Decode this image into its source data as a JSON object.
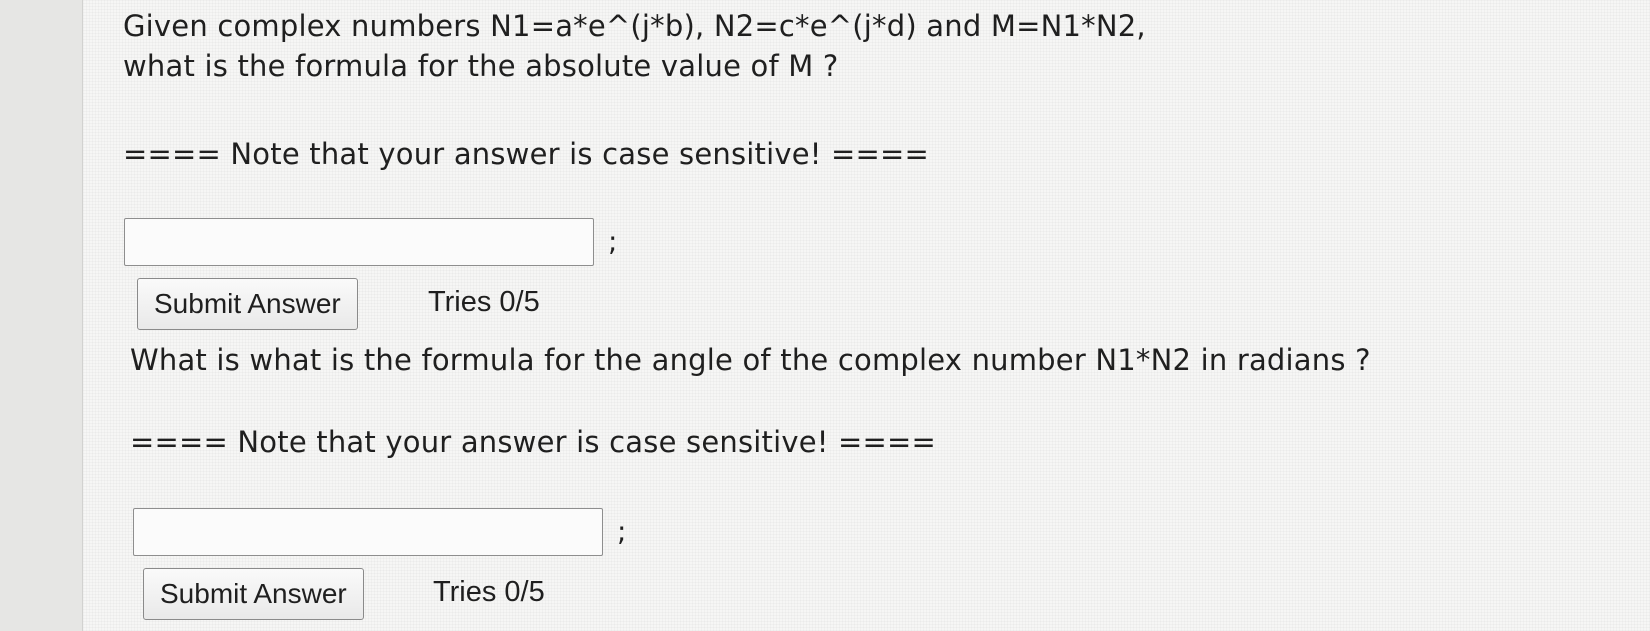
{
  "question1": {
    "line1": "Given complex numbers N1=a*e^(j*b), N2=c*e^(j*d) and M=N1*N2,",
    "line2": "what is the formula for the absolute value of M ?",
    "note": "==== Note that your answer is case sensitive! ====",
    "input_value": "",
    "semicolon": ";",
    "submit_label": "Submit Answer",
    "tries": "Tries 0/5"
  },
  "question2": {
    "line1": "What is what is the formula for the angle of the complex number N1*N2 in radians ?",
    "note": "==== Note that your answer is case sensitive! ====",
    "input_value": "",
    "semicolon": ";",
    "submit_label": "Submit Answer",
    "tries": "Tries 0/5"
  }
}
